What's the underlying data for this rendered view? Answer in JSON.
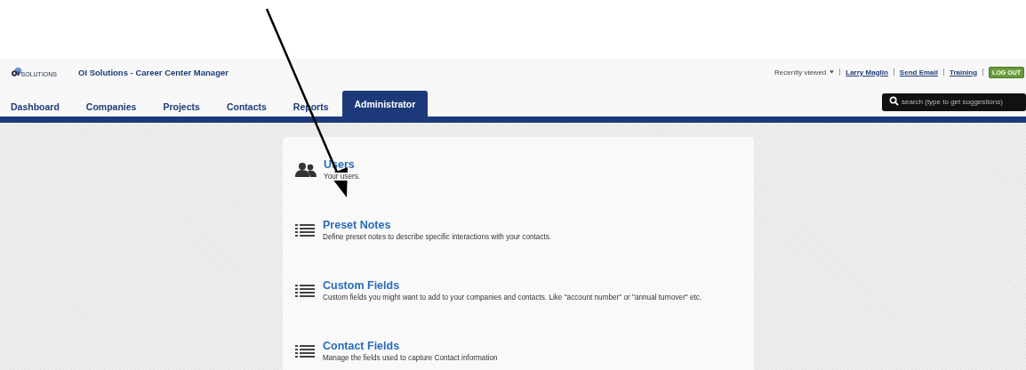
{
  "header": {
    "logo_text": "SOLUTIONS",
    "app_title": "OI Solutions - Career Center Manager",
    "recently_viewed": "Recently viewed",
    "user_links": [
      "Larry Maglin",
      "Send Email",
      "Training"
    ],
    "logout": "LOG OUT"
  },
  "tabs": [
    {
      "label": "Dashboard",
      "selected": false
    },
    {
      "label": "Companies",
      "selected": false
    },
    {
      "label": "Projects",
      "selected": false
    },
    {
      "label": "Contacts",
      "selected": false
    },
    {
      "label": "Reports",
      "selected": false
    },
    {
      "label": "Administrator",
      "selected": true
    }
  ],
  "search": {
    "placeholder": "search (type to get suggestions)"
  },
  "admin_items": [
    {
      "kind": "users",
      "title": "Users",
      "description": "Your users."
    },
    {
      "kind": "list",
      "title": "Preset Notes",
      "description": "Define preset notes to describe specific interactions with your contacts."
    },
    {
      "kind": "list",
      "title": "Custom Fields",
      "description": "Custom fields you might want to add to your companies and contacts. Like \"account number\" or \"annual turnover\" etc."
    },
    {
      "kind": "list",
      "title": "Contact Fields",
      "description": "Manage the fields used to capture Contact information"
    }
  ]
}
